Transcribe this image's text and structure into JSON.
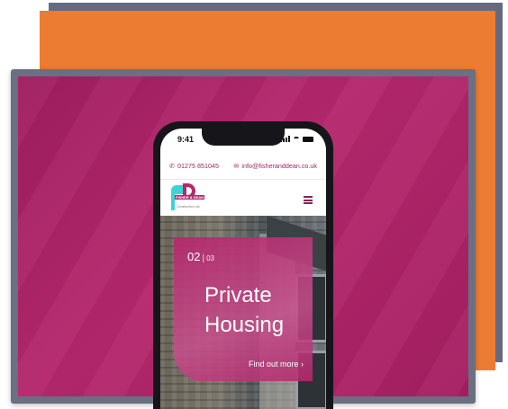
{
  "status_bar": {
    "time": "9:41"
  },
  "contact_bar": {
    "phone": "01275 851045",
    "email": "info@fisheranddean.co.uk",
    "phone_icon": "phone-icon",
    "email_icon": "envelope-icon"
  },
  "logo": {
    "name": "FISHER & DEAN",
    "subtitle": "Construction Ltd"
  },
  "menu": {
    "icon": "hamburger-icon"
  },
  "slide": {
    "current": "02",
    "separator": "|",
    "total": "03",
    "title_line1": "Private",
    "title_line2": "Housing",
    "cta": "Find out more ›"
  },
  "colors": {
    "magenta": "#b5286d",
    "orange": "#ec7c32",
    "slate": "#656a80",
    "teal": "#3fd3d6"
  }
}
